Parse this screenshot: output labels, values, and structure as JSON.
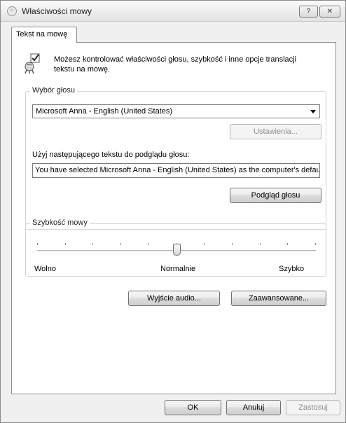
{
  "window": {
    "title": "Właściwości mowy",
    "help_label": "?",
    "close_label": "✕"
  },
  "tabs": [
    {
      "label": "Tekst na mowę",
      "selected": true
    }
  ],
  "intro": {
    "text": "Możesz kontrolować właściwości głosu, szybkość i inne opcje translacji tekstu na mowę.",
    "icon": "speech-properties-icon"
  },
  "voice_selection": {
    "group_label": "Wybór głosu",
    "selected_voice": "Microsoft Anna - English (United States)",
    "settings_label": "Ustawienia...",
    "preview_text_label": "Użyj następującego tekstu do podglądu głosu:",
    "preview_text_value": "You have selected Microsoft Anna - English (United States) as the computer's default",
    "preview_button_label": "Podgląd głosu"
  },
  "speech_rate": {
    "group_label": "Szybkość mowy",
    "label_slow": "Wolno",
    "label_normal": "Normalnie",
    "label_fast": "Szybko",
    "position_fraction": 0.5
  },
  "buttons": {
    "audio_output": "Wyjście audio...",
    "advanced": "Zaawansowane...",
    "ok": "OK",
    "cancel": "Anuluj",
    "apply": "Zastosuj"
  }
}
